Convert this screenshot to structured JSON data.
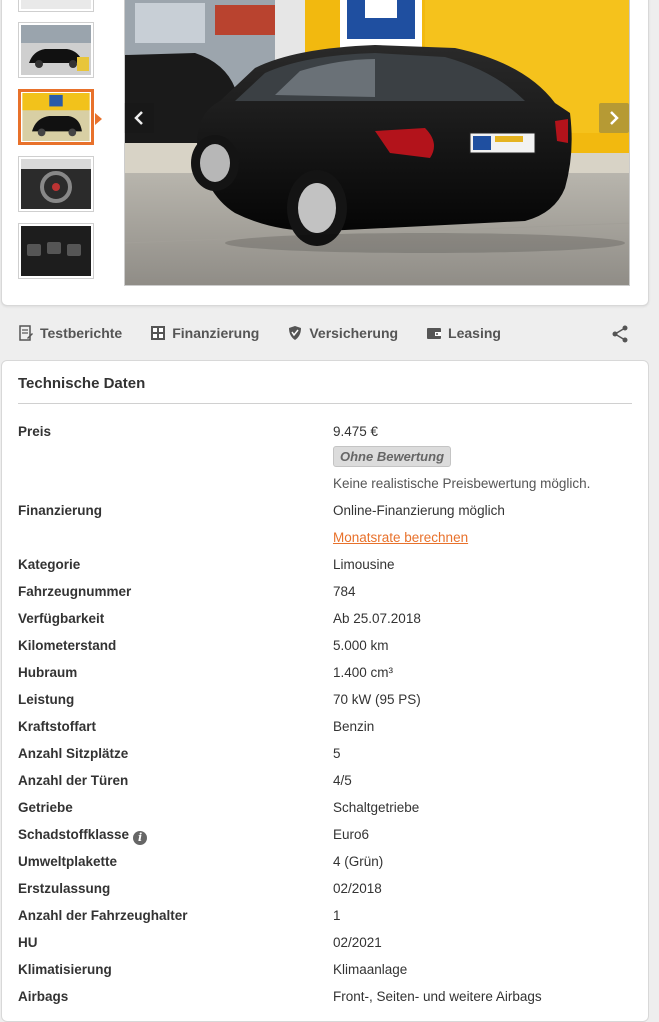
{
  "toolbar": {
    "testberichte": "Testberichte",
    "finanzierung": "Finanzierung",
    "versicherung": "Versicherung",
    "leasing": "Leasing"
  },
  "tech": {
    "title": "Technische Daten",
    "price_label": "Preis",
    "price_value": "9.475 €",
    "rating_badge": "Ohne Bewertung",
    "rating_note": "Keine realistische Preisbewertung möglich.",
    "finance_label": "Finanzierung",
    "finance_value": "Online-Finanzierung möglich",
    "finance_link": "Monatsrate berechnen",
    "rows": [
      {
        "label": "Kategorie",
        "value": "Limousine"
      },
      {
        "label": "Fahrzeugnummer",
        "value": "784"
      },
      {
        "label": "Verfügbarkeit",
        "value": "Ab 25.07.2018"
      },
      {
        "label": "Kilometerstand",
        "value": "5.000 km"
      },
      {
        "label": "Hubraum",
        "value": "1.400 cm³"
      },
      {
        "label": "Leistung",
        "value": "70 kW (95 PS)"
      },
      {
        "label": "Kraftstoffart",
        "value": "Benzin"
      },
      {
        "label": "Anzahl Sitzplätze",
        "value": "5"
      },
      {
        "label": "Anzahl der Türen",
        "value": "4/5"
      },
      {
        "label": "Getriebe",
        "value": "Schaltgetriebe"
      },
      {
        "label": "Schadstoffklasse",
        "value": "Euro6"
      },
      {
        "label": "Umweltplakette",
        "value": "4 (Grün)"
      },
      {
        "label": "Erstzulassung",
        "value": "02/2018"
      },
      {
        "label": "Anzahl der Fahrzeughalter",
        "value": "1"
      },
      {
        "label": "HU",
        "value": "02/2021"
      },
      {
        "label": "Klimatisierung",
        "value": "Klimaanlage"
      },
      {
        "label": "Airbags",
        "value": "Front-, Seiten- und weitere Airbags"
      }
    ]
  },
  "colors": {
    "accent": "#e8712b",
    "background": "#eeeeee"
  }
}
